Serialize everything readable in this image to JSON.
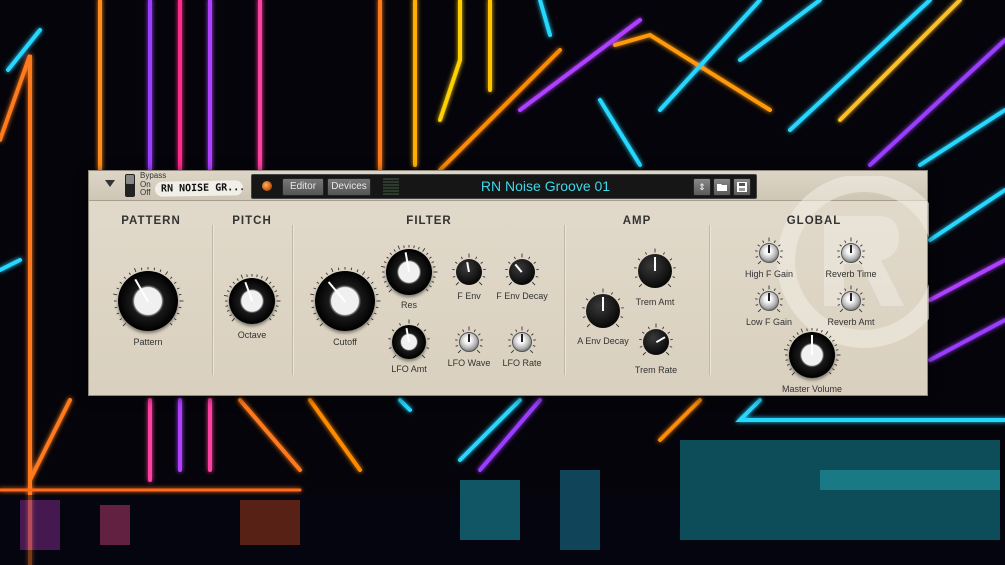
{
  "device": {
    "bypass_labels": [
      "Bypass",
      "On",
      "Off"
    ],
    "patch_label": "RN NOISE GR...",
    "editor_button": "Editor",
    "devices_button": "Devices",
    "patch_name": "RN Noise Groove 01",
    "icons": [
      "fold-arrow-icon",
      "power-led-icon",
      "up-down-arrows-icon",
      "folder-icon",
      "save-icon"
    ]
  },
  "sections": {
    "pattern": "PATTERN",
    "pitch": "PITCH",
    "filter": "FILTER",
    "amp": "AMP",
    "global": "GLOBAL"
  },
  "knobs": {
    "pattern": "Pattern",
    "octave": "Octave",
    "cutoff": "Cutoff",
    "res": "Res",
    "f_env": "F Env",
    "f_env_decay": "F Env Decay",
    "lfo_amt": "LFO Amt",
    "lfo_wave": "LFO Wave",
    "lfo_rate": "LFO Rate",
    "trem_amt": "Trem Amt",
    "a_env_decay": "A Env Decay",
    "trem_rate": "Trem Rate",
    "high_f_gain": "High F Gain",
    "reverb_time": "Reverb Time",
    "low_f_gain": "Low F Gain",
    "reverb_amt": "Reverb Amt",
    "master_volume": "Master Volume"
  },
  "colors": {
    "panel": "#dcd4c4",
    "patch_name_text": "#3fd6e8",
    "background": "#05040a"
  }
}
